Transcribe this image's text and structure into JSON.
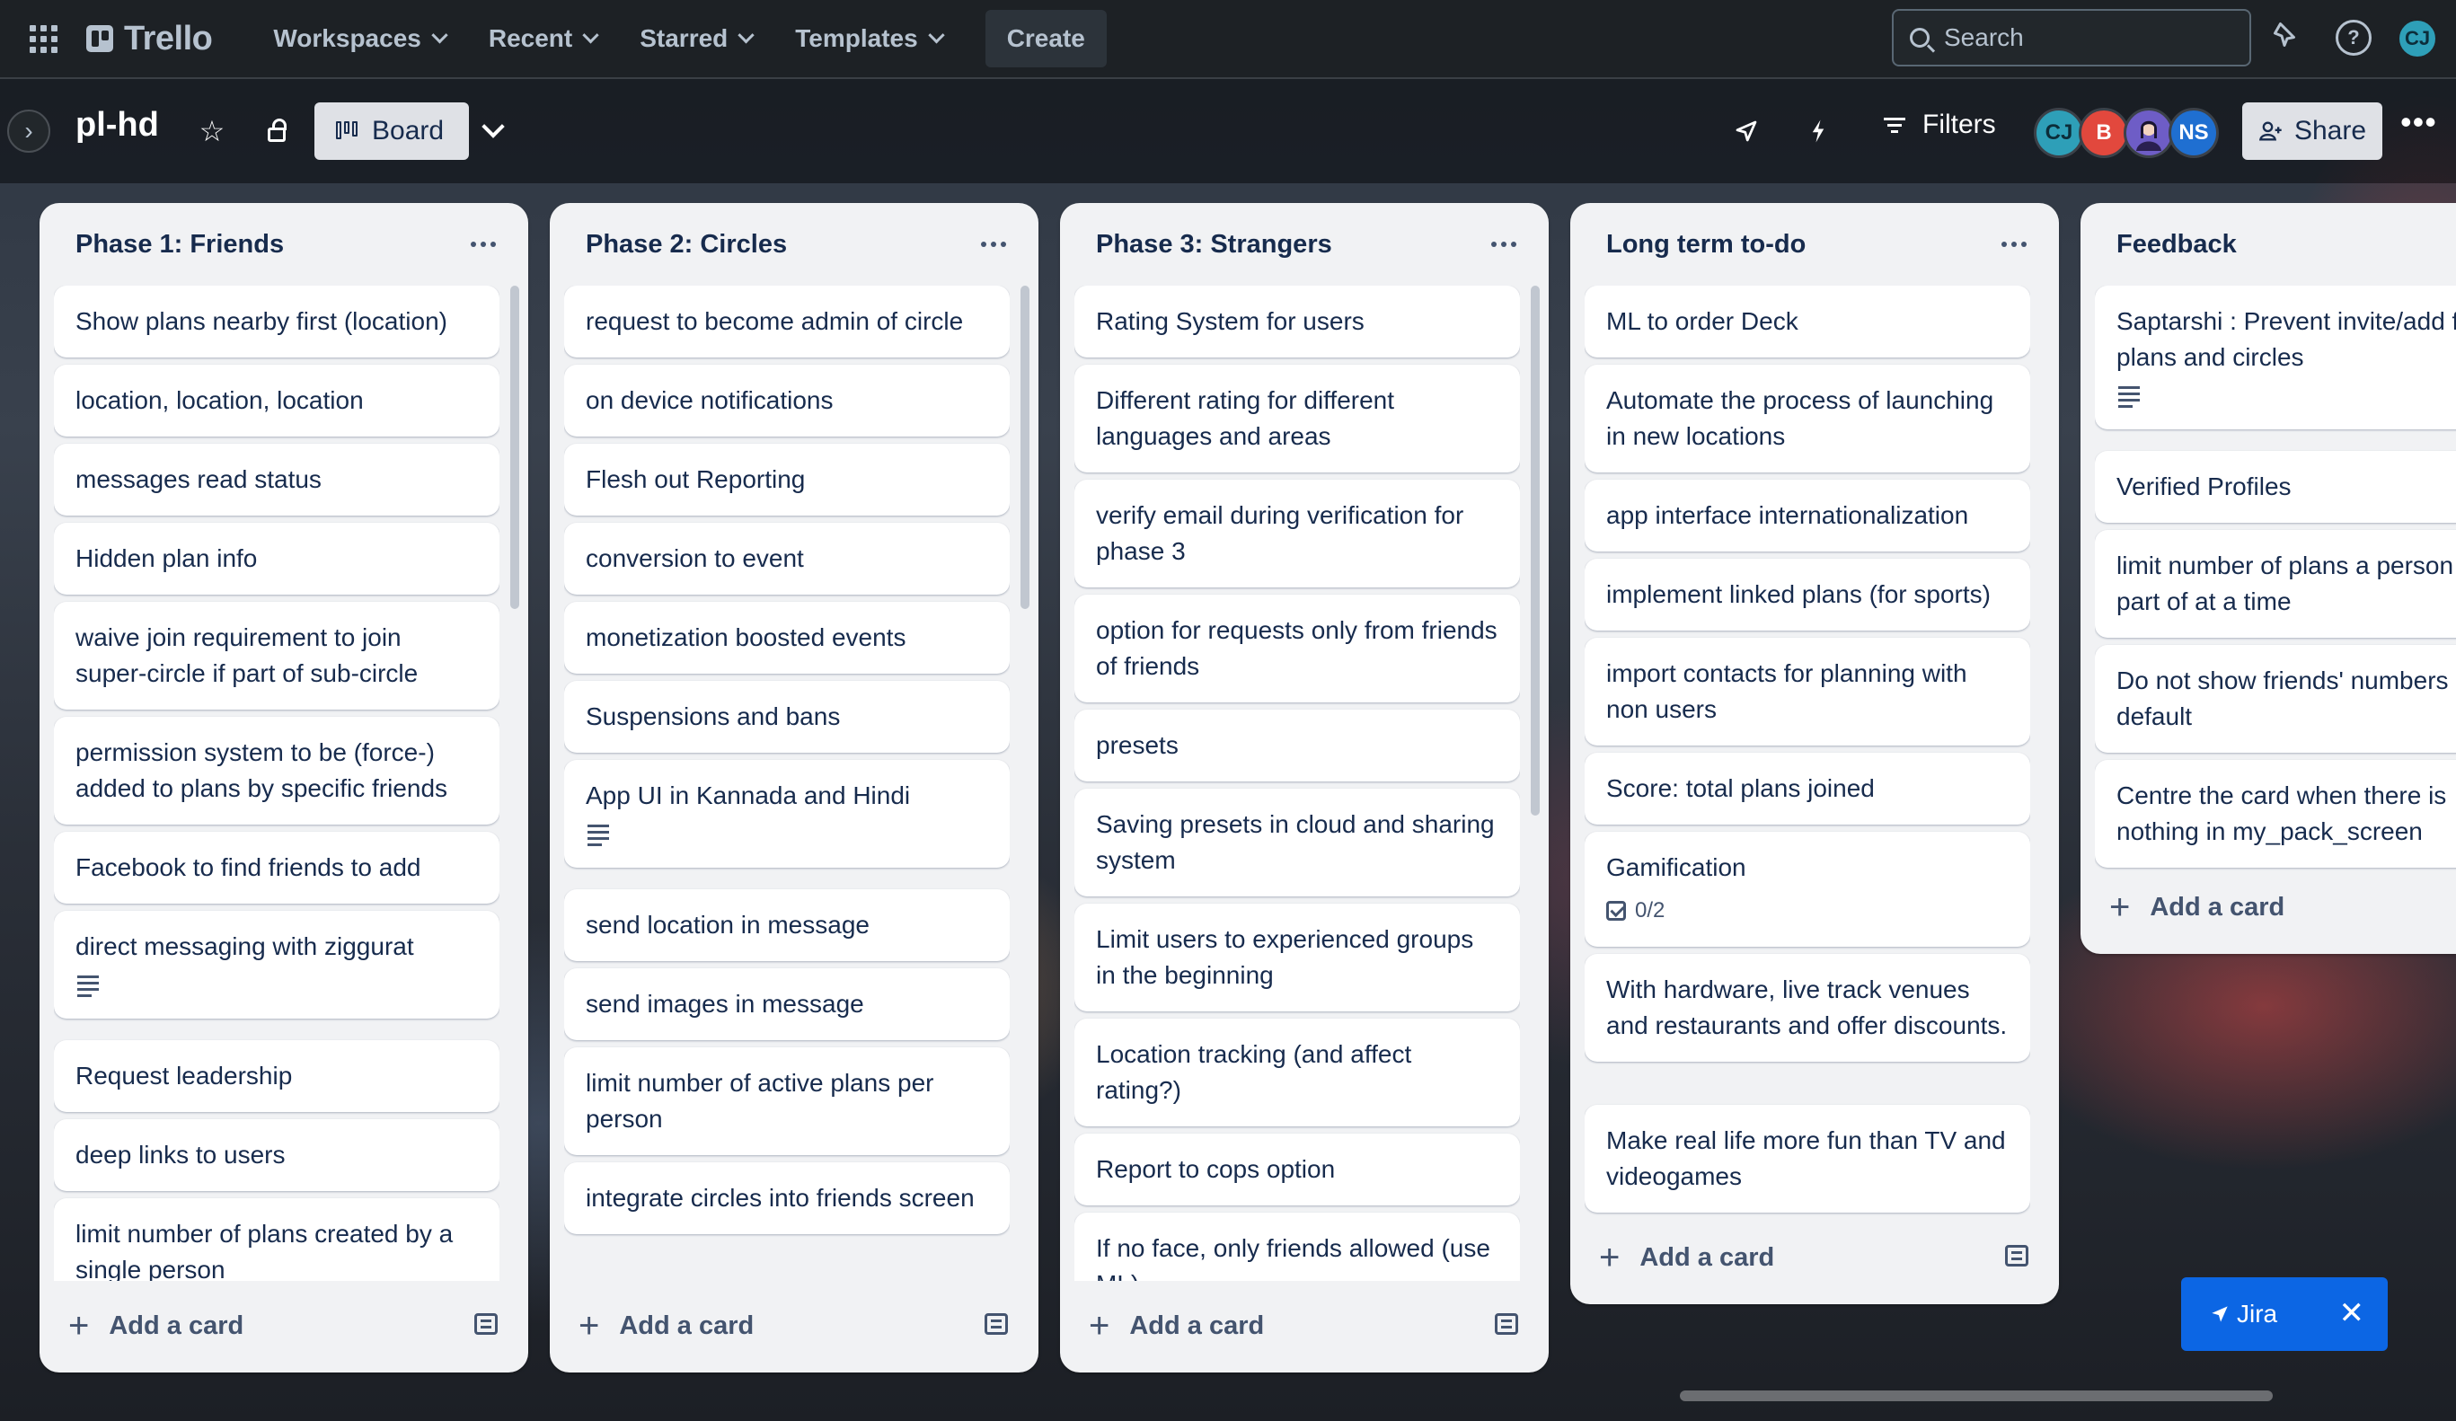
{
  "nav": {
    "logo": "Trello",
    "items": [
      {
        "label": "Workspaces"
      },
      {
        "label": "Recent"
      },
      {
        "label": "Starred"
      },
      {
        "label": "Templates"
      }
    ],
    "create_label": "Create",
    "search_placeholder": "Search",
    "user_initials": "CJ"
  },
  "board": {
    "title": "pl-hd",
    "view_label": "Board",
    "filters_label": "Filters",
    "share_label": "Share",
    "members": [
      {
        "initials": "CJ",
        "color": "#2e9fb8"
      },
      {
        "initials": "B",
        "color": "#e2483d"
      },
      {
        "initials": "",
        "color": "#6e5dc6"
      },
      {
        "initials": "NS",
        "color": "#1f6fd1"
      }
    ]
  },
  "lists": [
    {
      "title": "Phase 1: Friends",
      "add_label": "Add a card",
      "cards": [
        {
          "text": "Show plans nearby first (location)"
        },
        {
          "text": "location, location, location"
        },
        {
          "text": "messages read status"
        },
        {
          "text": "Hidden plan info"
        },
        {
          "text": "waive join requirement to join super-circle if part of sub-circle"
        },
        {
          "text": "permission system to be (force-) added to plans by specific friends"
        },
        {
          "text": "Facebook to find friends to add"
        },
        {
          "text": "direct messaging with ziggurat",
          "desc": true
        },
        {
          "text": "Request leadership"
        },
        {
          "text": "deep links to users"
        },
        {
          "text": "limit number of plans created by a single person"
        }
      ]
    },
    {
      "title": "Phase 2: Circles",
      "add_label": "Add a card",
      "cards": [
        {
          "text": "request to become admin of circle"
        },
        {
          "text": "on device notifications"
        },
        {
          "text": "Flesh out Reporting"
        },
        {
          "text": "conversion to event"
        },
        {
          "text": "monetization boosted events"
        },
        {
          "text": "Suspensions and bans"
        },
        {
          "text": "App UI in Kannada and Hindi",
          "desc": true
        },
        {
          "text": "send location in message"
        },
        {
          "text": "send images in message"
        },
        {
          "text": "limit number of active plans per person"
        },
        {
          "text": "integrate circles into friends screen"
        }
      ]
    },
    {
      "title": "Phase 3: Strangers",
      "add_label": "Add a card",
      "cards": [
        {
          "text": "Rating System for users"
        },
        {
          "text": "Different rating for different languages and areas"
        },
        {
          "text": "verify email during verification for phase 3"
        },
        {
          "text": "option for requests only from friends of friends"
        },
        {
          "text": "presets"
        },
        {
          "text": "Saving presets in cloud and sharing system"
        },
        {
          "text": "Limit users to experienced groups in the beginning"
        },
        {
          "text": "Location tracking (and affect rating?)"
        },
        {
          "text": "Report to cops option"
        },
        {
          "text": "If no face, only friends allowed (use ML)"
        }
      ]
    },
    {
      "title": "Long term to-do",
      "add_label": "Add a card",
      "cards": [
        {
          "text": "ML to order Deck"
        },
        {
          "text": "Automate the process of launching in new locations"
        },
        {
          "text": "app interface internationalization"
        },
        {
          "text": "implement linked plans (for sports)"
        },
        {
          "text": "import contacts for planning with non users"
        },
        {
          "text": "Score: total plans joined"
        },
        {
          "text": "Gamification",
          "checklist": "0/2"
        },
        {
          "text": "With hardware, live track venues and restaurants and offer discounts."
        },
        {
          "text": "Make real life more fun than TV and videogames"
        }
      ]
    },
    {
      "title": "Feedback",
      "add_label": "Add a card",
      "cards": [
        {
          "text": "Saptarshi : Prevent invite/add for plans and circles",
          "desc": true
        },
        {
          "text": "Verified Profiles"
        },
        {
          "text": "limit number of plans a person be a part of at a time"
        },
        {
          "text": "Do not show friends' numbers default"
        },
        {
          "text": "Centre the card when there is nothing in my_pack_screen"
        }
      ]
    }
  ],
  "jira": {
    "label": "Jira"
  }
}
